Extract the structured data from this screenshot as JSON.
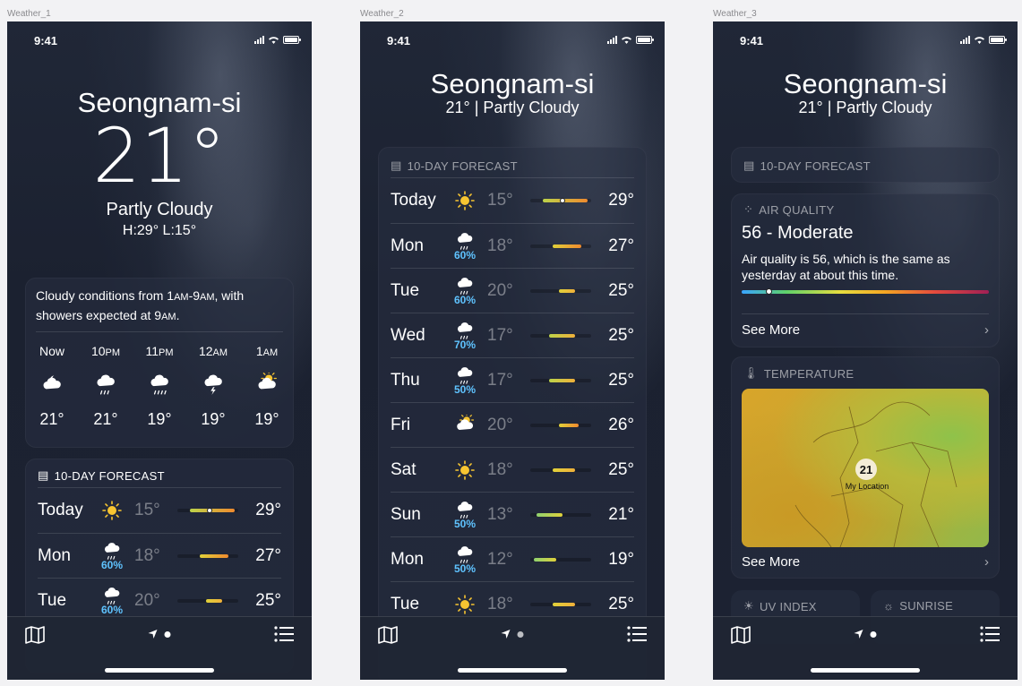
{
  "frames": [
    {
      "label": "Weather_1"
    },
    {
      "label": "Weather_2"
    },
    {
      "label": "Weather_3"
    }
  ],
  "status": {
    "time": "9:41"
  },
  "location": {
    "city": "Seongnam-si",
    "temp": "21°",
    "condition": "Partly Cloudy",
    "high_low": "H:29°  L:15°",
    "subline": "21°  |  Partly Cloudy"
  },
  "hourly": {
    "summary": "Cloudy conditions from 1AM-9AM, with showers expected at 9AM.",
    "items": [
      {
        "time": "Now",
        "icon": "cloud-moon-icon",
        "temp": "21°"
      },
      {
        "time": "10PM",
        "icon": "cloud-rain-icon",
        "temp": "21°"
      },
      {
        "time": "11PM",
        "icon": "cloud-heavy-rain-icon",
        "temp": "19°"
      },
      {
        "time": "12AM",
        "icon": "cloud-lightning-icon",
        "temp": "19°"
      },
      {
        "time": "1AM",
        "icon": "cloud-sun-icon",
        "temp": "19°"
      }
    ]
  },
  "forecast": {
    "title": "10-DAY FORECAST",
    "days": [
      {
        "day": "Today",
        "icon": "sun-icon",
        "pct": "",
        "low": "15°",
        "high": "29°",
        "low_val": 15,
        "high_val": 29,
        "current": 21
      },
      {
        "day": "Mon",
        "icon": "rain-icon",
        "pct": "60%",
        "low": "18°",
        "high": "27°",
        "low_val": 18,
        "high_val": 27
      },
      {
        "day": "Tue",
        "icon": "rain-icon",
        "pct": "60%",
        "low": "20°",
        "high": "25°",
        "low_val": 20,
        "high_val": 25
      },
      {
        "day": "Wed",
        "icon": "rain-icon",
        "pct": "70%",
        "low": "17°",
        "high": "25°",
        "low_val": 17,
        "high_val": 25
      },
      {
        "day": "Thu",
        "icon": "rain-icon",
        "pct": "50%",
        "low": "17°",
        "high": "25°",
        "low_val": 17,
        "high_val": 25
      },
      {
        "day": "Fri",
        "icon": "cloud-sun-icon",
        "pct": "",
        "low": "20°",
        "high": "26°",
        "low_val": 20,
        "high_val": 26
      },
      {
        "day": "Sat",
        "icon": "sun-icon",
        "pct": "",
        "low": "18°",
        "high": "25°",
        "low_val": 18,
        "high_val": 25
      },
      {
        "day": "Sun",
        "icon": "rain-icon",
        "pct": "50%",
        "low": "13°",
        "high": "21°",
        "low_val": 13,
        "high_val": 21
      },
      {
        "day": "Mon",
        "icon": "rain-icon",
        "pct": "50%",
        "low": "12°",
        "high": "19°",
        "low_val": 12,
        "high_val": 19
      },
      {
        "day": "Tue",
        "icon": "sun-icon",
        "pct": "",
        "low": "18°",
        "high": "25°",
        "low_val": 18,
        "high_val": 25
      }
    ],
    "scale_min": 11,
    "scale_max": 30
  },
  "air_quality": {
    "title": "AIR QUALITY",
    "value": "56 - Moderate",
    "description": "Air quality is 56, which is the same as yesterday at about this time.",
    "level": 0.11,
    "see_more": "See More"
  },
  "temperature_map": {
    "title": "TEMPERATURE",
    "pin": "21",
    "pin_label": "My Location",
    "see_more": "See More"
  },
  "more_cards": {
    "uv": "UV INDEX",
    "sunrise": "SUNRISE"
  },
  "colors": {
    "precip": "#5fc3ff",
    "sun": "#f7c531"
  }
}
